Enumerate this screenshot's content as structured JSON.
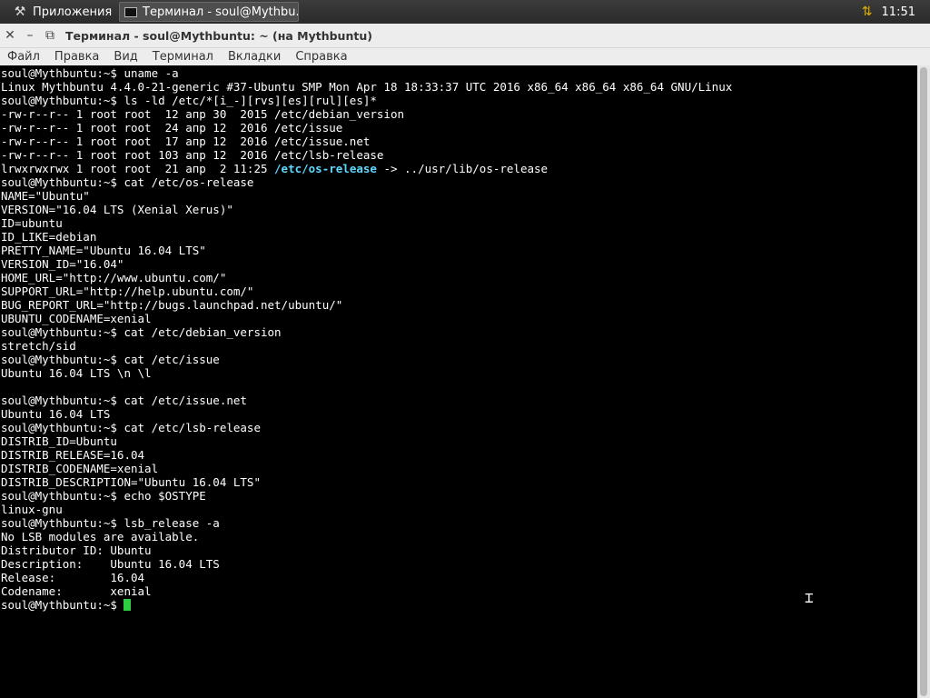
{
  "panel": {
    "apps_label": "Приложения",
    "task_label": "Терминал - soul@Mythbu...",
    "clock": "11:51"
  },
  "window": {
    "title": "Терминал - soul@Mythbuntu: ~ (на Mythbuntu)",
    "menu": [
      "Файл",
      "Правка",
      "Вид",
      "Терминал",
      "Вкладки",
      "Справка"
    ]
  },
  "terminal": {
    "lines": [
      "soul@Mythbuntu:~$ uname -a",
      "Linux Mythbuntu 4.4.0-21-generic #37-Ubuntu SMP Mon Apr 18 18:33:37 UTC 2016 x86_64 x86_64 x86_64 GNU/Linux",
      "soul@Mythbuntu:~$ ls -ld /etc/*[i_-][rvs][es][rul][es]*",
      "-rw-r--r-- 1 root root  12 апр 30  2015 /etc/debian_version",
      "-rw-r--r-- 1 root root  24 апр 12  2016 /etc/issue",
      "-rw-r--r-- 1 root root  17 апр 12  2016 /etc/issue.net",
      "-rw-r--r-- 1 root root 103 апр 12  2016 /etc/lsb-release",
      "lrwxrwxrwx 1 root root  21 апр  2 11:25 ",
      "soul@Mythbuntu:~$ cat /etc/os-release",
      "NAME=\"Ubuntu\"",
      "VERSION=\"16.04 LTS (Xenial Xerus)\"",
      "ID=ubuntu",
      "ID_LIKE=debian",
      "PRETTY_NAME=\"Ubuntu 16.04 LTS\"",
      "VERSION_ID=\"16.04\"",
      "HOME_URL=\"http://www.ubuntu.com/\"",
      "SUPPORT_URL=\"http://help.ubuntu.com/\"",
      "BUG_REPORT_URL=\"http://bugs.launchpad.net/ubuntu/\"",
      "UBUNTU_CODENAME=xenial",
      "soul@Mythbuntu:~$ cat /etc/debian_version",
      "stretch/sid",
      "soul@Mythbuntu:~$ cat /etc/issue",
      "Ubuntu 16.04 LTS \\n \\l",
      "",
      "soul@Mythbuntu:~$ cat /etc/issue.net",
      "Ubuntu 16.04 LTS",
      "soul@Mythbuntu:~$ cat /etc/lsb-release",
      "DISTRIB_ID=Ubuntu",
      "DISTRIB_RELEASE=16.04",
      "DISTRIB_CODENAME=xenial",
      "DISTRIB_DESCRIPTION=\"Ubuntu 16.04 LTS\"",
      "soul@Mythbuntu:~$ echo $OSTYPE",
      "linux-gnu",
      "soul@Mythbuntu:~$ lsb_release -a",
      "No LSB modules are available.",
      "Distributor ID: Ubuntu",
      "Description:    Ubuntu 16.04 LTS",
      "Release:        16.04",
      "Codename:       xenial",
      "soul@Mythbuntu:~$ "
    ],
    "symlink_name": "/etc/os-release",
    "symlink_target": " -> ../usr/lib/os-release",
    "link_color": "#5fd7ff",
    "cursor_color": "#2ecc40"
  }
}
